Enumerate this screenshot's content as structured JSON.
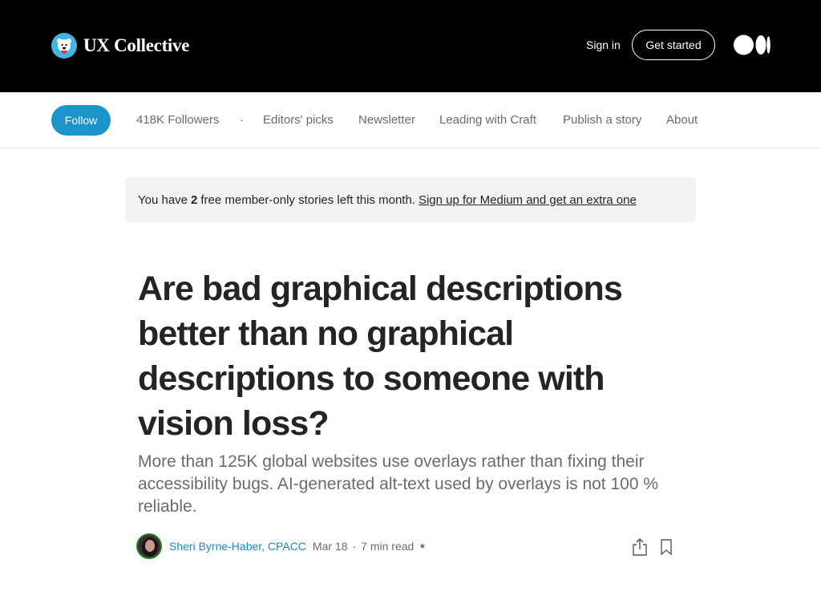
{
  "header": {
    "brand_name": "UX Collective",
    "brand_logo_icon": "polar-bear-icon",
    "signin_label": "Sign in",
    "get_started_label": "Get started",
    "medium_logo_icon": "medium-logo-icon"
  },
  "pubnav": {
    "follow_label": "Follow",
    "followers": "418K Followers",
    "dot": "·",
    "items": [
      "Editors' picks",
      "Newsletter",
      "Leading with Craft",
      "Publish a story",
      "About"
    ]
  },
  "banner": {
    "prefix": "You have",
    "count": "2",
    "suffix": "free member-only stories left this month.",
    "link": "Sign up for Medium and get an extra one",
    "background": "#f2f2f2"
  },
  "article": {
    "title": "Are bad graphical descriptions better than no graphical descriptions to someone with vision loss?",
    "subtitle": "More than 125K global websites use overlays rather than fixing their accessibility bugs. AI-generated alt-text used by overlays is not 100 % reliable."
  },
  "byline": {
    "author": "Sheri Byrne-Haber, CPACC",
    "date": "Mar 18",
    "sep": "·",
    "read_time": "7 min read",
    "member_icon": "star-icon",
    "share_icon": "share-icon",
    "bookmark_icon": "bookmark-icon"
  },
  "colors": {
    "header_bg": "#000000",
    "follow_accent": "#1a94c9",
    "author_link": "#1a8ac7",
    "text": "#242424",
    "muted": "#6b6b6b"
  }
}
